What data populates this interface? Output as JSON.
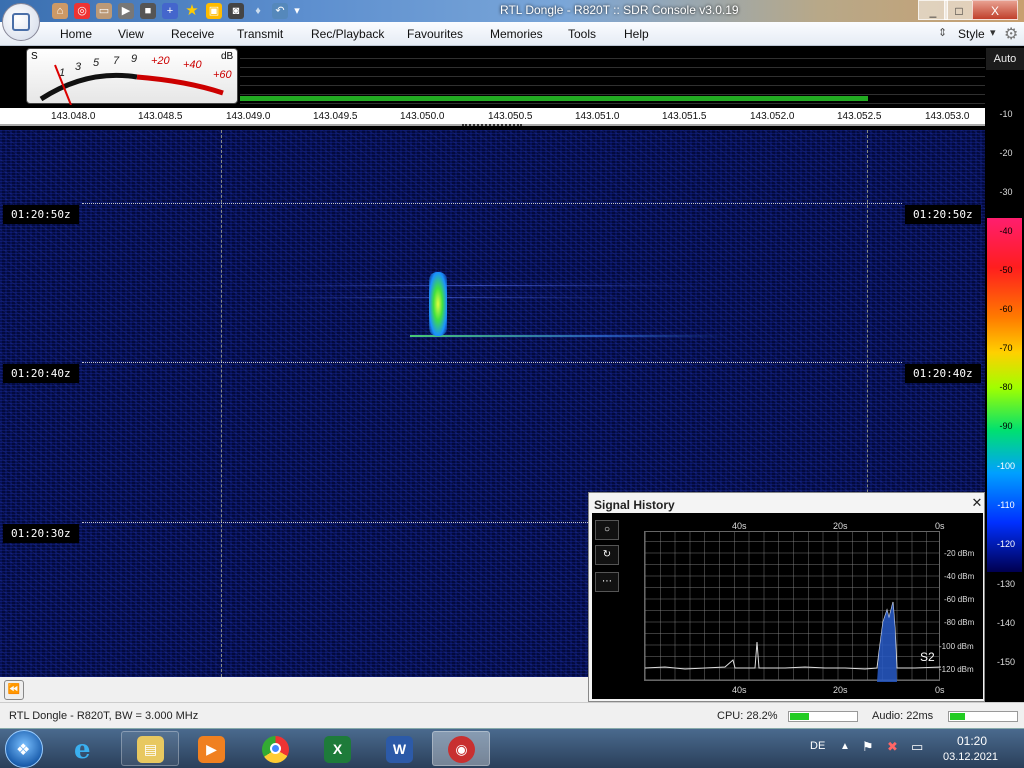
{
  "window": {
    "title": "RTL Dongle - R820T :: SDR Console v3.0.19",
    "controls": [
      "_",
      "□",
      "X"
    ]
  },
  "menu": {
    "items": [
      "Home",
      "View",
      "Receive",
      "Transmit",
      "Rec/Playback",
      "Favourites",
      "Memories",
      "Tools",
      "Help"
    ],
    "style_label": "Style"
  },
  "meter": {
    "s_label": "S",
    "db_label": "dB",
    "scale_s": [
      "1",
      "3",
      "5",
      "7",
      "9"
    ],
    "scale_db": [
      "+20",
      "+40",
      "+60"
    ]
  },
  "frequency_scale": [
    "143.048.0",
    "143.048.5",
    "143.049.0",
    "143.049.5",
    "143.050.0",
    "143.050.5",
    "143.051.0",
    "143.051.5",
    "143.052.0",
    "143.052.5",
    "143.053.0"
  ],
  "db_scale": {
    "auto_label": "Auto",
    "labels": [
      "-10",
      "-20",
      "-30",
      "-40",
      "-50",
      "-60",
      "-70",
      "-80",
      "-90",
      "-100",
      "-110",
      "-120",
      "-130",
      "-140",
      "-150"
    ]
  },
  "waterfall": {
    "timestamps": [
      "01:20:50z",
      "01:20:40z",
      "01:20:30z"
    ]
  },
  "signal_history": {
    "title": "Signal History",
    "close": "✕",
    "buttons": [
      "○",
      "↻",
      "⋯"
    ],
    "x_labels": [
      "40s",
      "20s",
      "0s"
    ],
    "y_labels": [
      "-20 dBm",
      "-40 dBm",
      "-60 dBm",
      "-80 dBm",
      "-100 dBm",
      "-120 dBm"
    ],
    "s_reading": "S2"
  },
  "status": {
    "device": "RTL Dongle - R820T, BW = 3.000 MHz",
    "cpu": "CPU: 28.2%",
    "cpu_level": 0.282,
    "audio": "Audio: 22ms",
    "audio_level": 0.22
  },
  "taskbar": {
    "apps": [
      "Internet Explorer",
      "Windows Explorer",
      "Media Player",
      "Chrome",
      "Excel",
      "Word",
      "SDR Console"
    ],
    "language": "DE",
    "time": "01:20",
    "date": "03.12.2021"
  }
}
